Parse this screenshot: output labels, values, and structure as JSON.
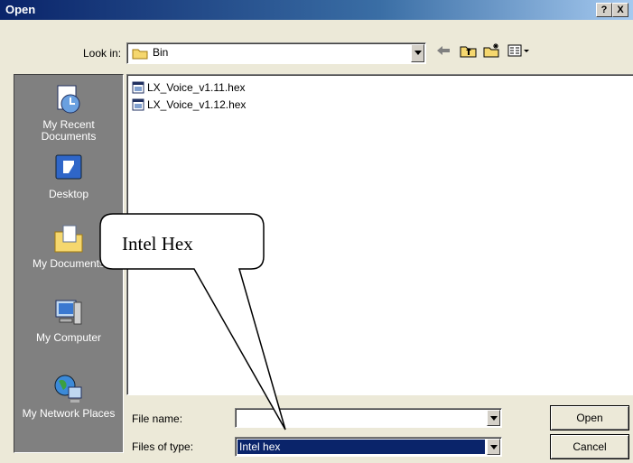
{
  "window": {
    "title": "Open",
    "help_glyph": "?",
    "close_glyph": "X"
  },
  "look_in": {
    "label": "Look in:",
    "folder": "Bin"
  },
  "places": [
    {
      "label": "My Recent Documents"
    },
    {
      "label": "Desktop"
    },
    {
      "label": "My Documents"
    },
    {
      "label": "My Computer"
    },
    {
      "label": "My Network Places"
    }
  ],
  "files": [
    {
      "name": "LX_Voice_v1.11.hex"
    },
    {
      "name": "LX_Voice_v1.12.hex"
    }
  ],
  "file_name": {
    "label": "File name:",
    "value": ""
  },
  "files_of_type": {
    "label": "Files of type:",
    "value": "Intel hex"
  },
  "buttons": {
    "open": "Open",
    "cancel": "Cancel"
  },
  "callout": {
    "text": "Intel Hex"
  }
}
